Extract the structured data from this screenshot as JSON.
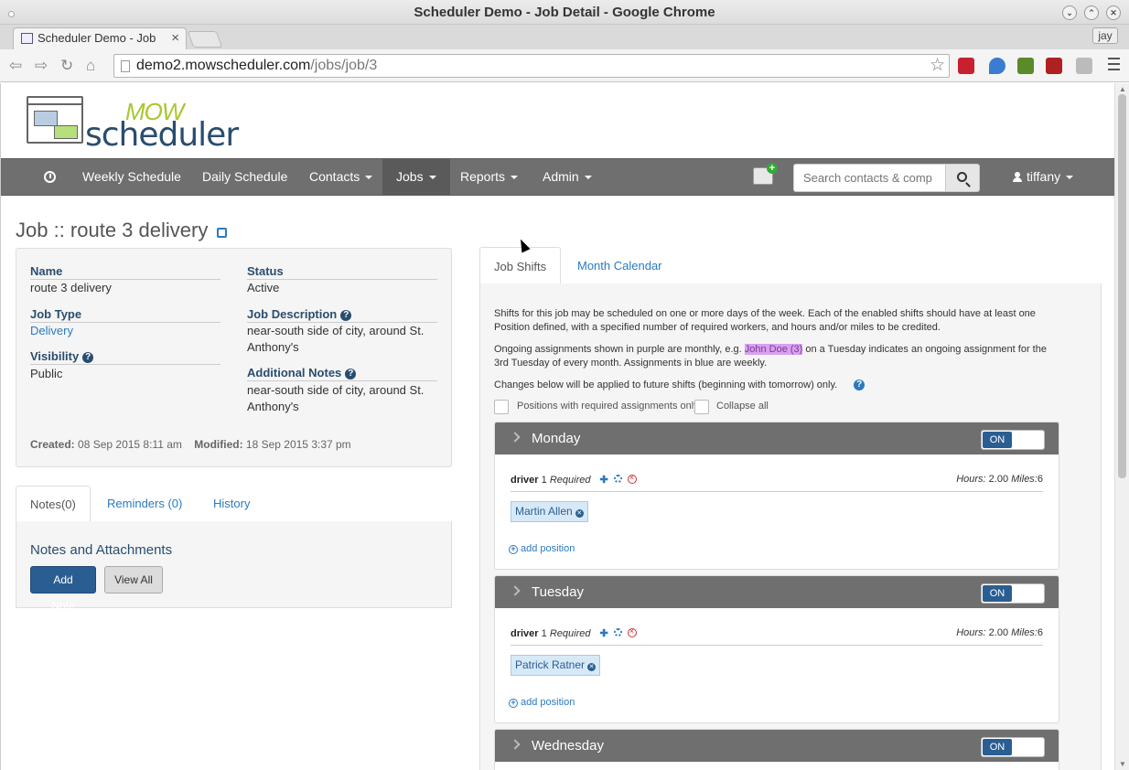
{
  "window": {
    "title": "Scheduler Demo - Job Detail - Google Chrome"
  },
  "browser": {
    "tab_label": "Scheduler Demo - Job",
    "url_host": "demo2.mowscheduler.com",
    "url_path": "/jobs/job/3",
    "profile": "jay"
  },
  "logo": {
    "mow": "MOW",
    "scheduler": "scheduler"
  },
  "nav": {
    "weekly": "Weekly Schedule",
    "daily": "Daily Schedule",
    "contacts": "Contacts",
    "jobs": "Jobs",
    "reports": "Reports",
    "admin": "Admin",
    "search_placeholder": "Search contacts & comp",
    "user": "tiffany"
  },
  "page": {
    "title": "Job :: route 3 delivery"
  },
  "job": {
    "name_label": "Name",
    "name": "route 3 delivery",
    "type_label": "Job Type",
    "type": "Delivery",
    "visibility_label": "Visibility",
    "visibility": "Public",
    "status_label": "Status",
    "status": "Active",
    "description_label": "Job Description",
    "description_1": "near-south side of city, around St.",
    "description_2": "Anthony's",
    "notes_label": "Additional Notes",
    "notes_1": "near-south side of city, around St.",
    "notes_2": "Anthony's",
    "created_label": "Created:",
    "created": "08 Sep 2015 8:11 am",
    "modified_label": "Modified:",
    "modified": "18 Sep 2015 3:37 pm"
  },
  "notes_tabs": {
    "notes": "Notes(0)",
    "reminders": "Reminders (0)",
    "history": "History",
    "heading": "Notes and Attachments",
    "add": "Add Note",
    "view": "View All"
  },
  "shift_tabs": {
    "shifts": "Job Shifts",
    "calendar": "Month Calendar"
  },
  "shifts": {
    "intro_1": "Shifts for this job may be scheduled on one or more days of the week. Each of the enabled shifts should have at least one",
    "intro_2": "Position defined, with a specified number of required workers, and hours and/or miles to be credited.",
    "ongoing_pre": "Ongoing assignments shown in purple are monthly, e.g. ",
    "ongoing_hl": "John Doe (3)",
    "ongoing_post": " on a Tuesday indicates an ongoing assignment for the",
    "ongoing_2": "3rd Tuesday of every month. Assignments in blue are weekly.",
    "changes": "Changes below will be applied to future shifts (beginning with tomorrow) only.",
    "opt_required": "Positions with required assignments only",
    "opt_collapse": "Collapse all",
    "days": [
      {
        "name": "Monday",
        "toggle": "ON",
        "position": "driver",
        "count": "1",
        "required": "Required",
        "hours_label": "Hours:",
        "hours": "2.00",
        "miles_label": "Miles:",
        "miles": "6",
        "assignee": "Martin Allen",
        "add": "add position"
      },
      {
        "name": "Tuesday",
        "toggle": "ON",
        "position": "driver",
        "count": "1",
        "required": "Required",
        "hours_label": "Hours:",
        "hours": "2.00",
        "miles_label": "Miles:",
        "miles": "6",
        "assignee": "Patrick Ratner",
        "add": "add position"
      },
      {
        "name": "Wednesday",
        "toggle": "ON"
      }
    ]
  }
}
